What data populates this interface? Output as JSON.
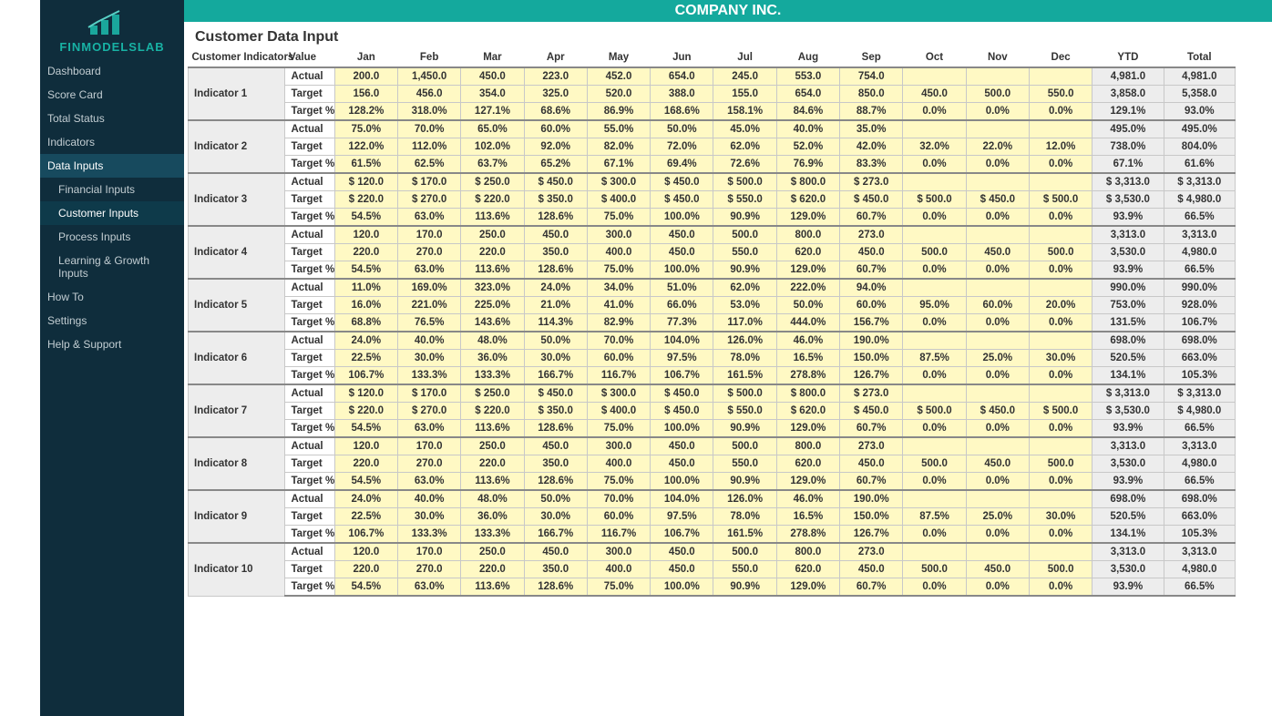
{
  "header": {
    "company": "COMPANY INC."
  },
  "page": {
    "title": "Customer Data Input"
  },
  "logo": {
    "brand": "FINMODELSLAB"
  },
  "sidebar": {
    "items": [
      {
        "label": "Dashboard"
      },
      {
        "label": "Score Card"
      },
      {
        "label": "Total Status"
      },
      {
        "label": "Indicators"
      },
      {
        "label": "Data Inputs",
        "activeParent": true
      },
      {
        "label": "Financial Inputs",
        "sub": true
      },
      {
        "label": "Customer Inputs",
        "sub": true,
        "activeSub": true
      },
      {
        "label": "Process Inputs",
        "sub": true
      },
      {
        "label": "Learning & Growth Inputs",
        "sub": true
      },
      {
        "label": "How To"
      },
      {
        "label": "Settings"
      },
      {
        "label": "Help & Support"
      }
    ]
  },
  "table": {
    "columns": [
      "Customer Indicators",
      "Value",
      "Jan",
      "Feb",
      "Mar",
      "Apr",
      "May",
      "Jun",
      "Jul",
      "Aug",
      "Sep",
      "Oct",
      "Nov",
      "Dec",
      "YTD",
      "Total"
    ],
    "valueLabels": [
      "Actual",
      "Target",
      "Target %"
    ],
    "indicators": [
      {
        "name": "Indicator 1",
        "actual": [
          "200.0",
          "1,450.0",
          "450.0",
          "223.0",
          "452.0",
          "654.0",
          "245.0",
          "553.0",
          "754.0",
          "",
          "",
          "",
          "4,981.0",
          "4,981.0"
        ],
        "target": [
          "156.0",
          "456.0",
          "354.0",
          "325.0",
          "520.0",
          "388.0",
          "155.0",
          "654.0",
          "850.0",
          "450.0",
          "500.0",
          "550.0",
          "3,858.0",
          "5,358.0"
        ],
        "targetpc": [
          "128.2%",
          "318.0%",
          "127.1%",
          "68.6%",
          "86.9%",
          "168.6%",
          "158.1%",
          "84.6%",
          "88.7%",
          "0.0%",
          "0.0%",
          "0.0%",
          "129.1%",
          "93.0%"
        ]
      },
      {
        "name": "Indicator 2",
        "actual": [
          "75.0%",
          "70.0%",
          "65.0%",
          "60.0%",
          "55.0%",
          "50.0%",
          "45.0%",
          "40.0%",
          "35.0%",
          "",
          "",
          "",
          "495.0%",
          "495.0%"
        ],
        "target": [
          "122.0%",
          "112.0%",
          "102.0%",
          "92.0%",
          "82.0%",
          "72.0%",
          "62.0%",
          "52.0%",
          "42.0%",
          "32.0%",
          "22.0%",
          "12.0%",
          "738.0%",
          "804.0%"
        ],
        "targetpc": [
          "61.5%",
          "62.5%",
          "63.7%",
          "65.2%",
          "67.1%",
          "69.4%",
          "72.6%",
          "76.9%",
          "83.3%",
          "0.0%",
          "0.0%",
          "0.0%",
          "67.1%",
          "61.6%"
        ]
      },
      {
        "name": "Indicator 3",
        "actual": [
          "$ 120.0",
          "$ 170.0",
          "$ 250.0",
          "$ 450.0",
          "$ 300.0",
          "$ 450.0",
          "$ 500.0",
          "$ 800.0",
          "$ 273.0",
          "",
          "",
          "",
          "$ 3,313.0",
          "$ 3,313.0"
        ],
        "target": [
          "$ 220.0",
          "$ 270.0",
          "$ 220.0",
          "$ 350.0",
          "$ 400.0",
          "$ 450.0",
          "$ 550.0",
          "$ 620.0",
          "$ 450.0",
          "$ 500.0",
          "$ 450.0",
          "$ 500.0",
          "$ 3,530.0",
          "$ 4,980.0"
        ],
        "targetpc": [
          "54.5%",
          "63.0%",
          "113.6%",
          "128.6%",
          "75.0%",
          "100.0%",
          "90.9%",
          "129.0%",
          "60.7%",
          "0.0%",
          "0.0%",
          "0.0%",
          "93.9%",
          "66.5%"
        ]
      },
      {
        "name": "Indicator 4",
        "actual": [
          "120.0",
          "170.0",
          "250.0",
          "450.0",
          "300.0",
          "450.0",
          "500.0",
          "800.0",
          "273.0",
          "",
          "",
          "",
          "3,313.0",
          "3,313.0"
        ],
        "target": [
          "220.0",
          "270.0",
          "220.0",
          "350.0",
          "400.0",
          "450.0",
          "550.0",
          "620.0",
          "450.0",
          "500.0",
          "450.0",
          "500.0",
          "3,530.0",
          "4,980.0"
        ],
        "targetpc": [
          "54.5%",
          "63.0%",
          "113.6%",
          "128.6%",
          "75.0%",
          "100.0%",
          "90.9%",
          "129.0%",
          "60.7%",
          "0.0%",
          "0.0%",
          "0.0%",
          "93.9%",
          "66.5%"
        ]
      },
      {
        "name": "Indicator 5",
        "actual": [
          "11.0%",
          "169.0%",
          "323.0%",
          "24.0%",
          "34.0%",
          "51.0%",
          "62.0%",
          "222.0%",
          "94.0%",
          "",
          "",
          "",
          "990.0%",
          "990.0%"
        ],
        "target": [
          "16.0%",
          "221.0%",
          "225.0%",
          "21.0%",
          "41.0%",
          "66.0%",
          "53.0%",
          "50.0%",
          "60.0%",
          "95.0%",
          "60.0%",
          "20.0%",
          "753.0%",
          "928.0%"
        ],
        "targetpc": [
          "68.8%",
          "76.5%",
          "143.6%",
          "114.3%",
          "82.9%",
          "77.3%",
          "117.0%",
          "444.0%",
          "156.7%",
          "0.0%",
          "0.0%",
          "0.0%",
          "131.5%",
          "106.7%"
        ]
      },
      {
        "name": "Indicator 6",
        "actual": [
          "24.0%",
          "40.0%",
          "48.0%",
          "50.0%",
          "70.0%",
          "104.0%",
          "126.0%",
          "46.0%",
          "190.0%",
          "",
          "",
          "",
          "698.0%",
          "698.0%"
        ],
        "target": [
          "22.5%",
          "30.0%",
          "36.0%",
          "30.0%",
          "60.0%",
          "97.5%",
          "78.0%",
          "16.5%",
          "150.0%",
          "87.5%",
          "25.0%",
          "30.0%",
          "520.5%",
          "663.0%"
        ],
        "targetpc": [
          "106.7%",
          "133.3%",
          "133.3%",
          "166.7%",
          "116.7%",
          "106.7%",
          "161.5%",
          "278.8%",
          "126.7%",
          "0.0%",
          "0.0%",
          "0.0%",
          "134.1%",
          "105.3%"
        ]
      },
      {
        "name": "Indicator 7",
        "actual": [
          "$ 120.0",
          "$ 170.0",
          "$ 250.0",
          "$ 450.0",
          "$ 300.0",
          "$ 450.0",
          "$ 500.0",
          "$ 800.0",
          "$ 273.0",
          "",
          "",
          "",
          "$ 3,313.0",
          "$ 3,313.0"
        ],
        "target": [
          "$ 220.0",
          "$ 270.0",
          "$ 220.0",
          "$ 350.0",
          "$ 400.0",
          "$ 450.0",
          "$ 550.0",
          "$ 620.0",
          "$ 450.0",
          "$ 500.0",
          "$ 450.0",
          "$ 500.0",
          "$ 3,530.0",
          "$ 4,980.0"
        ],
        "targetpc": [
          "54.5%",
          "63.0%",
          "113.6%",
          "128.6%",
          "75.0%",
          "100.0%",
          "90.9%",
          "129.0%",
          "60.7%",
          "0.0%",
          "0.0%",
          "0.0%",
          "93.9%",
          "66.5%"
        ]
      },
      {
        "name": "Indicator 8",
        "actual": [
          "120.0",
          "170.0",
          "250.0",
          "450.0",
          "300.0",
          "450.0",
          "500.0",
          "800.0",
          "273.0",
          "",
          "",
          "",
          "3,313.0",
          "3,313.0"
        ],
        "target": [
          "220.0",
          "270.0",
          "220.0",
          "350.0",
          "400.0",
          "450.0",
          "550.0",
          "620.0",
          "450.0",
          "500.0",
          "450.0",
          "500.0",
          "3,530.0",
          "4,980.0"
        ],
        "targetpc": [
          "54.5%",
          "63.0%",
          "113.6%",
          "128.6%",
          "75.0%",
          "100.0%",
          "90.9%",
          "129.0%",
          "60.7%",
          "0.0%",
          "0.0%",
          "0.0%",
          "93.9%",
          "66.5%"
        ]
      },
      {
        "name": "Indicator 9",
        "actual": [
          "24.0%",
          "40.0%",
          "48.0%",
          "50.0%",
          "70.0%",
          "104.0%",
          "126.0%",
          "46.0%",
          "190.0%",
          "",
          "",
          "",
          "698.0%",
          "698.0%"
        ],
        "target": [
          "22.5%",
          "30.0%",
          "36.0%",
          "30.0%",
          "60.0%",
          "97.5%",
          "78.0%",
          "16.5%",
          "150.0%",
          "87.5%",
          "25.0%",
          "30.0%",
          "520.5%",
          "663.0%"
        ],
        "targetpc": [
          "106.7%",
          "133.3%",
          "133.3%",
          "166.7%",
          "116.7%",
          "106.7%",
          "161.5%",
          "278.8%",
          "126.7%",
          "0.0%",
          "0.0%",
          "0.0%",
          "134.1%",
          "105.3%"
        ]
      },
      {
        "name": "Indicator 10",
        "actual": [
          "120.0",
          "170.0",
          "250.0",
          "450.0",
          "300.0",
          "450.0",
          "500.0",
          "800.0",
          "273.0",
          "",
          "",
          "",
          "3,313.0",
          "3,313.0"
        ],
        "target": [
          "220.0",
          "270.0",
          "220.0",
          "350.0",
          "400.0",
          "450.0",
          "550.0",
          "620.0",
          "450.0",
          "500.0",
          "450.0",
          "500.0",
          "3,530.0",
          "4,980.0"
        ],
        "targetpc": [
          "54.5%",
          "63.0%",
          "113.6%",
          "128.6%",
          "75.0%",
          "100.0%",
          "90.9%",
          "129.0%",
          "60.7%",
          "0.0%",
          "0.0%",
          "0.0%",
          "93.9%",
          "66.5%"
        ]
      }
    ]
  }
}
